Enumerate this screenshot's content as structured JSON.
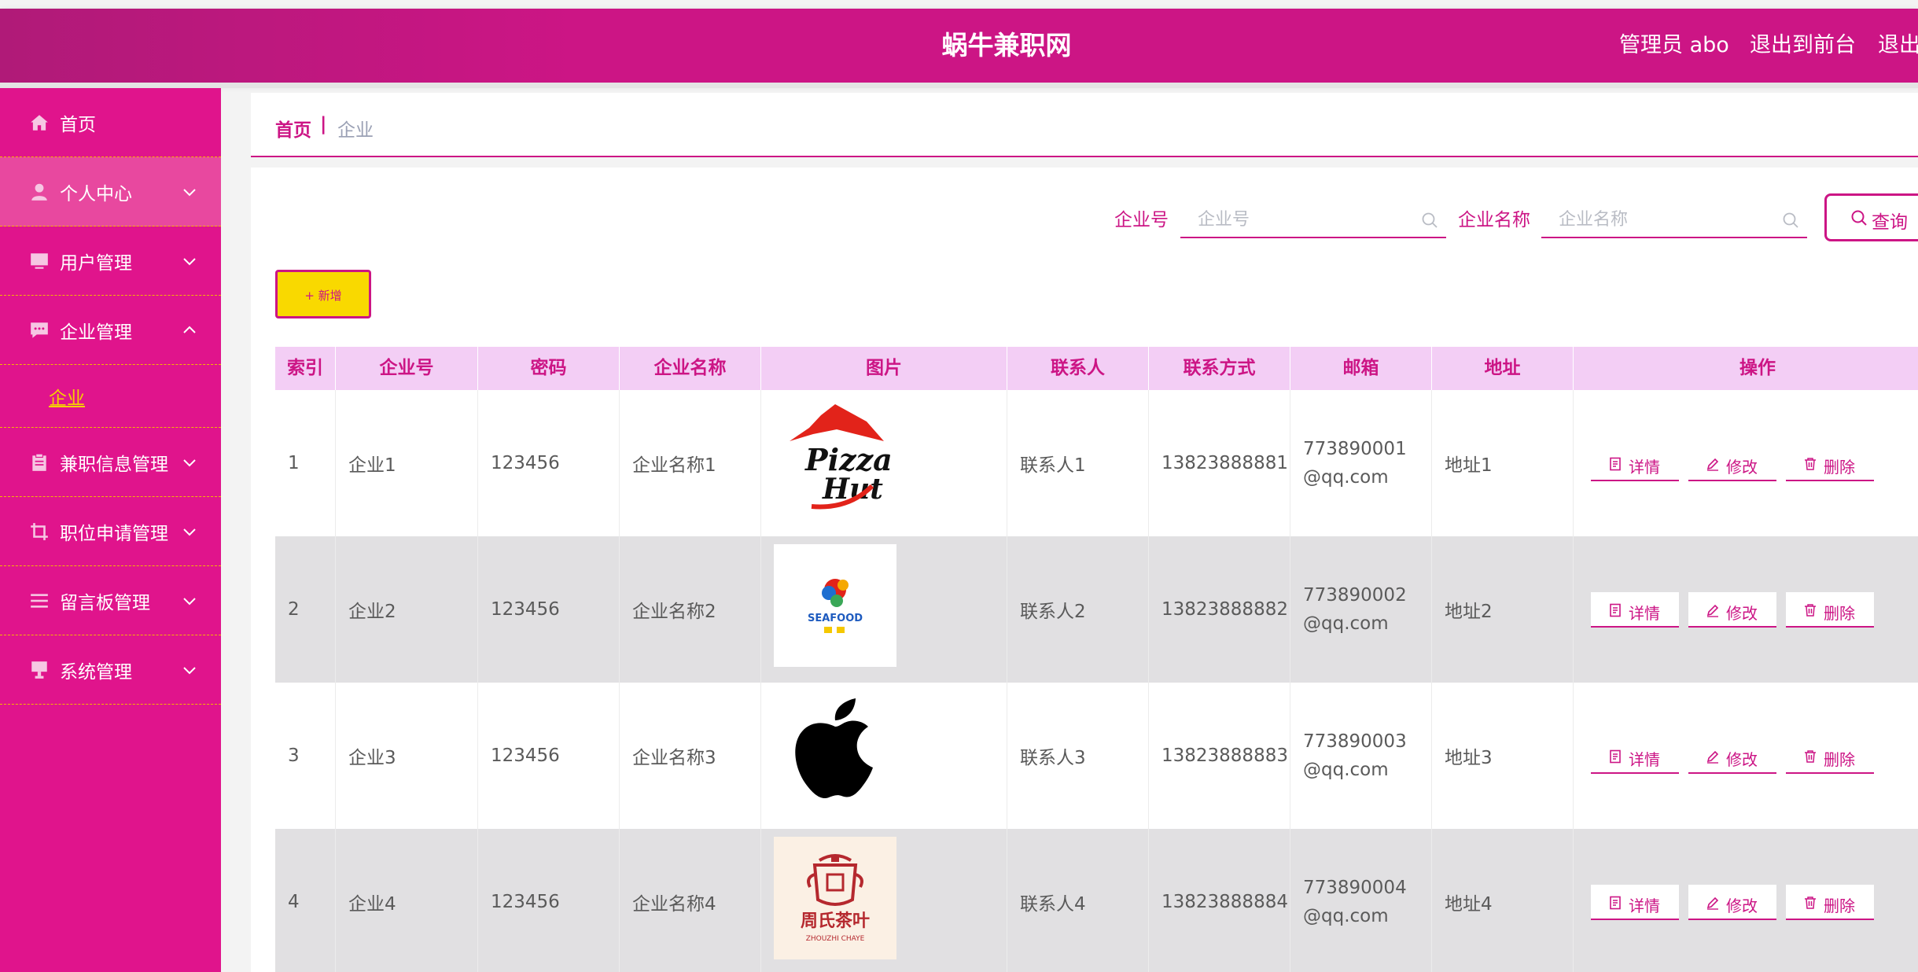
{
  "header": {
    "title": "蜗牛兼职网",
    "admin_label": "管理员 abo",
    "front_label": "退出到前台",
    "logout_label": "退出登录"
  },
  "sidebar": {
    "items": [
      {
        "label": "首页",
        "icon": "home-icon",
        "arrow": "none"
      },
      {
        "label": "个人中心",
        "icon": "user-icon",
        "arrow": "down"
      },
      {
        "label": "用户管理",
        "icon": "monitor-icon",
        "arrow": "down"
      },
      {
        "label": "企业管理",
        "icon": "message-icon",
        "arrow": "up"
      },
      {
        "label": "兼职信息管理",
        "icon": "clipboard-icon",
        "arrow": "down"
      },
      {
        "label": "职位申请管理",
        "icon": "crop-icon",
        "arrow": "down"
      },
      {
        "label": "留言板管理",
        "icon": "list-icon",
        "arrow": "down"
      },
      {
        "label": "系统管理",
        "icon": "stand-icon",
        "arrow": "down"
      }
    ],
    "sub_item": "企业"
  },
  "breadcrumb": {
    "home": "首页",
    "separator": "|",
    "current": "企业"
  },
  "search": {
    "company_no_label": "企业号",
    "company_no_placeholder": "企业号",
    "company_no_value": "",
    "company_name_label": "企业名称",
    "company_name_placeholder": "企业名称",
    "company_name_value": "",
    "query_label": "查询"
  },
  "add_button": "+ 新增",
  "table": {
    "columns": [
      "索引",
      "企业号",
      "密码",
      "企业名称",
      "图片",
      "联系人",
      "联系方式",
      "邮箱",
      "地址",
      "操作"
    ],
    "rows": [
      {
        "index": "1",
        "company_no": "企业1",
        "password": "123456",
        "company_name": "企业名称1",
        "image": "pizza-hut-logo",
        "contact": "联系人1",
        "phone": "13823888881",
        "email": "773890001@qq.com",
        "address": "地址1"
      },
      {
        "index": "2",
        "company_no": "企业2",
        "password": "123456",
        "company_name": "企业名称2",
        "image": "seafood-logo",
        "contact": "联系人2",
        "phone": "13823888882",
        "email": "773890002@qq.com",
        "address": "地址2"
      },
      {
        "index": "3",
        "company_no": "企业3",
        "password": "123456",
        "company_name": "企业名称3",
        "image": "apple-logo",
        "contact": "联系人3",
        "phone": "13823888883",
        "email": "773890003@qq.com",
        "address": "地址3"
      },
      {
        "index": "4",
        "company_no": "企业4",
        "password": "123456",
        "company_name": "企业名称4",
        "image": "zhouzhi-tea-logo",
        "contact": "联系人4",
        "phone": "13823888884",
        "email": "773890004@qq.com",
        "address": "地址4"
      }
    ],
    "actions": {
      "detail": "详情",
      "edit": "修改",
      "delete": "删除"
    }
  },
  "logo_text": {
    "pizza_top": "Pizza",
    "pizza_bottom": "Hut",
    "seafood": "SEAFOOD",
    "zhouzhi_cn": "周氏茶叶",
    "zhouzhi_en": "ZHOUZHI CHAYE"
  },
  "colors": {
    "brand": "#cc1585",
    "sidebar": "#e0148c",
    "accent_yellow": "#f9d900",
    "header_cell": "#f3cef5",
    "row_alt": "#e1e0e2"
  }
}
